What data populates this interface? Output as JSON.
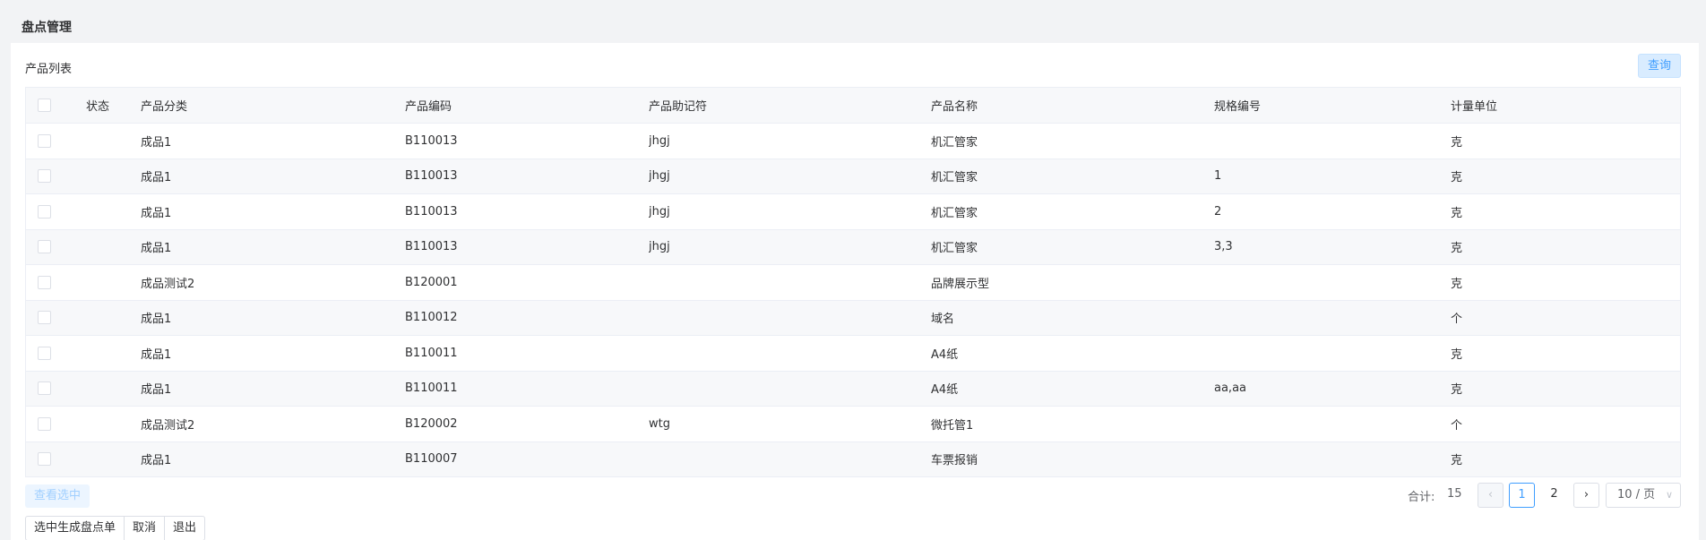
{
  "page": {
    "title": "盘点管理"
  },
  "list": {
    "title": "产品列表",
    "query_label": "查询"
  },
  "table": {
    "headers": [
      "状态",
      "产品分类",
      "产品编码",
      "产品助记符",
      "产品名称",
      "规格编号",
      "计量单位"
    ],
    "rows": [
      {
        "category": "成品1",
        "code": "B110013",
        "mnemonic": "jhgj",
        "name": "机汇管家",
        "spec": "",
        "unit": "克"
      },
      {
        "category": "成品1",
        "code": "B110013",
        "mnemonic": "jhgj",
        "name": "机汇管家",
        "spec": "1",
        "unit": "克"
      },
      {
        "category": "成品1",
        "code": "B110013",
        "mnemonic": "jhgj",
        "name": "机汇管家",
        "spec": "2",
        "unit": "克"
      },
      {
        "category": "成品1",
        "code": "B110013",
        "mnemonic": "jhgj",
        "name": "机汇管家",
        "spec": "3,3",
        "unit": "克"
      },
      {
        "category": "成品测试2",
        "code": "B120001",
        "mnemonic": "",
        "name": "品牌展示型",
        "spec": "",
        "unit": "克"
      },
      {
        "category": "成品1",
        "code": "B110012",
        "mnemonic": "",
        "name": "域名",
        "spec": "",
        "unit": "个"
      },
      {
        "category": "成品1",
        "code": "B110011",
        "mnemonic": "",
        "name": "A4纸",
        "spec": "",
        "unit": "克"
      },
      {
        "category": "成品1",
        "code": "B110011",
        "mnemonic": "",
        "name": "A4纸",
        "spec": "aa,aa",
        "unit": "克"
      },
      {
        "category": "成品测试2",
        "code": "B120002",
        "mnemonic": "wtg",
        "name": "微托管1",
        "spec": "",
        "unit": "个"
      },
      {
        "category": "成品1",
        "code": "B110007",
        "mnemonic": "",
        "name": "车票报销",
        "spec": "",
        "unit": "克"
      }
    ]
  },
  "footer": {
    "view_selected_label": "查看选中",
    "total_label": "合计:",
    "total_value": "15",
    "prev_icon": "chevron-left-icon",
    "next_icon": "chevron-right-icon",
    "pages": [
      "1",
      "2"
    ],
    "current_page": "1",
    "page_size_label": "10 / 页",
    "buttons": [
      "选中生成盘点单",
      "取消",
      "退出"
    ]
  }
}
